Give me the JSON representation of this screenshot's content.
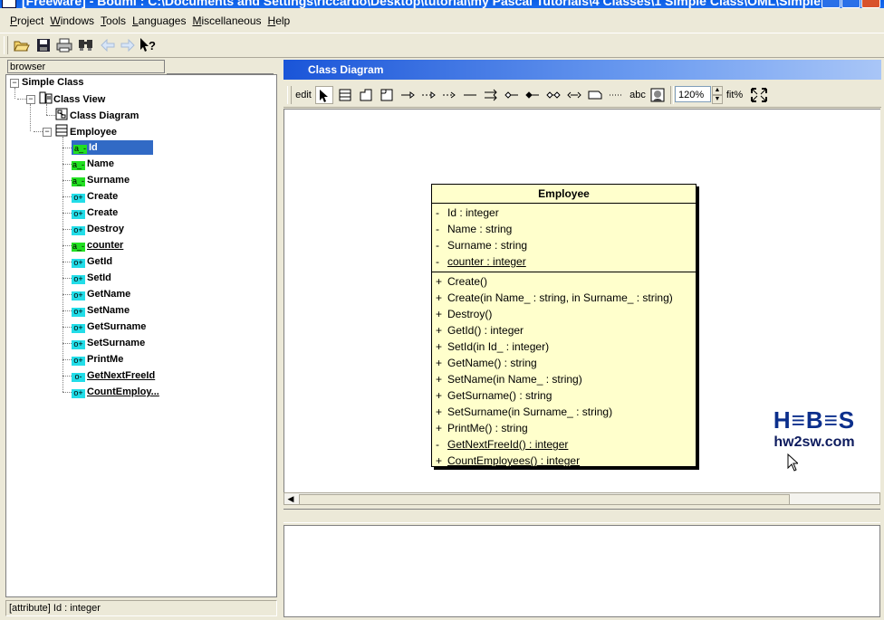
{
  "window": {
    "title": "[Freeware] - Bouml : C:\\Documents and Settings\\riccardo\\Desktop\\tutorial\\my Pascal Tutorials\\4 Classes\\1 Simple Class\\OML\\Simple ..."
  },
  "menu": [
    {
      "label": "Project",
      "mnemonic": "P",
      "rest": "roject"
    },
    {
      "label": "Windows",
      "mnemonic": "W",
      "rest": "indows"
    },
    {
      "label": "Tools",
      "mnemonic": "T",
      "rest": "ools"
    },
    {
      "label": "Languages",
      "mnemonic": "L",
      "rest": "anguages"
    },
    {
      "label": "Miscellaneous",
      "mnemonic": "M",
      "rest": "iscellaneous"
    },
    {
      "label": "Help",
      "mnemonic": "H",
      "rest": "elp"
    }
  ],
  "toolbar": {
    "icons": [
      "open-icon",
      "save-icon",
      "print-icon",
      "find-icon",
      "back-icon",
      "forward-icon",
      "whats-this-icon"
    ]
  },
  "browser": {
    "tab_label": "browser",
    "tree": {
      "root": "Simple Class",
      "class_view": "Class View",
      "class_diagram": "Class Diagram",
      "class_name": "Employee",
      "members": [
        {
          "kind": "attribute",
          "badge": "a_-",
          "label": "Id",
          "selected": true,
          "static": false
        },
        {
          "kind": "attribute",
          "badge": "a_-",
          "label": "Name",
          "selected": false,
          "static": false
        },
        {
          "kind": "attribute",
          "badge": "a_-",
          "label": "Surname",
          "selected": false,
          "static": false
        },
        {
          "kind": "operation",
          "badge": "o+",
          "label": "Create",
          "selected": false,
          "static": false
        },
        {
          "kind": "operation",
          "badge": "o+",
          "label": "Create",
          "selected": false,
          "static": false
        },
        {
          "kind": "operation",
          "badge": "o+",
          "label": "Destroy",
          "selected": false,
          "static": false
        },
        {
          "kind": "attribute",
          "badge": "a_-",
          "label": "counter",
          "selected": false,
          "static": true
        },
        {
          "kind": "operation",
          "badge": "o+",
          "label": "GetId",
          "selected": false,
          "static": false
        },
        {
          "kind": "operation",
          "badge": "o+",
          "label": "SetId",
          "selected": false,
          "static": false
        },
        {
          "kind": "operation",
          "badge": "o+",
          "label": "GetName",
          "selected": false,
          "static": false
        },
        {
          "kind": "operation",
          "badge": "o+",
          "label": "SetName",
          "selected": false,
          "static": false
        },
        {
          "kind": "operation",
          "badge": "o+",
          "label": "GetSurname",
          "selected": false,
          "static": false
        },
        {
          "kind": "operation",
          "badge": "o+",
          "label": "SetSurname",
          "selected": false,
          "static": false
        },
        {
          "kind": "operation",
          "badge": "o+",
          "label": "PrintMe",
          "selected": false,
          "static": false
        },
        {
          "kind": "operation",
          "badge": "o-",
          "label": "GetNextFreeId",
          "selected": false,
          "static": true
        },
        {
          "kind": "operation",
          "badge": "o+",
          "label": "CountEmploy...",
          "selected": false,
          "static": true
        }
      ]
    }
  },
  "status": {
    "text": "[attribute] Id : integer"
  },
  "diagram": {
    "title": "Class Diagram",
    "edit_label": "edit",
    "tools": [
      "select-arrow-icon",
      "class-icon",
      "package-icon",
      "fragment-icon",
      "generalisation-icon",
      "realization-icon",
      "dependency-icon",
      "association-icon",
      "directional-association-icon",
      "aggregation-icon",
      "directional-aggregation-icon",
      "composition-icon",
      "directional-composition-icon",
      "note-icon",
      "anchor-icon",
      "text-icon",
      "image-icon"
    ],
    "text_tool_label": "abc",
    "zoom": "120%",
    "fit_label": "fit%",
    "class_box": {
      "name": "Employee",
      "attributes": [
        {
          "vis": "-",
          "text": "Id : integer",
          "static": false
        },
        {
          "vis": "-",
          "text": "Name : string",
          "static": false
        },
        {
          "vis": "-",
          "text": "Surname : string",
          "static": false
        },
        {
          "vis": "-",
          "text": "counter : integer",
          "static": true
        }
      ],
      "operations": [
        {
          "vis": "+",
          "text": "Create()",
          "static": false
        },
        {
          "vis": "+",
          "text": "Create(in Name_ : string, in Surname_ : string)",
          "static": false
        },
        {
          "vis": "+",
          "text": "Destroy()",
          "static": false
        },
        {
          "vis": "+",
          "text": "GetId() : integer",
          "static": false
        },
        {
          "vis": "+",
          "text": "SetId(in Id_ : integer)",
          "static": false
        },
        {
          "vis": "+",
          "text": "GetName() : string",
          "static": false
        },
        {
          "vis": "+",
          "text": "SetName(in Name_ : string)",
          "static": false
        },
        {
          "vis": "+",
          "text": "GetSurname() : string",
          "static": false
        },
        {
          "vis": "+",
          "text": "SetSurname(in Surname_ : string)",
          "static": false
        },
        {
          "vis": "+",
          "text": "PrintMe() : string",
          "static": false
        },
        {
          "vis": "-",
          "text": "GetNextFreeId() : integer",
          "static": true
        },
        {
          "vis": "+",
          "text": "CountEmployees() : integer",
          "static": true
        }
      ]
    }
  },
  "watermark": {
    "logo": "H≡B≡S",
    "site": "hw2sw.com"
  },
  "colors": {
    "titlebar": "#0a5ee6",
    "selection": "#316ac5",
    "attribute_badge": "#22e022",
    "operation_badge": "#22dde8",
    "class_fill": "#ffffcc",
    "diagram_header": "#1a55d8"
  }
}
